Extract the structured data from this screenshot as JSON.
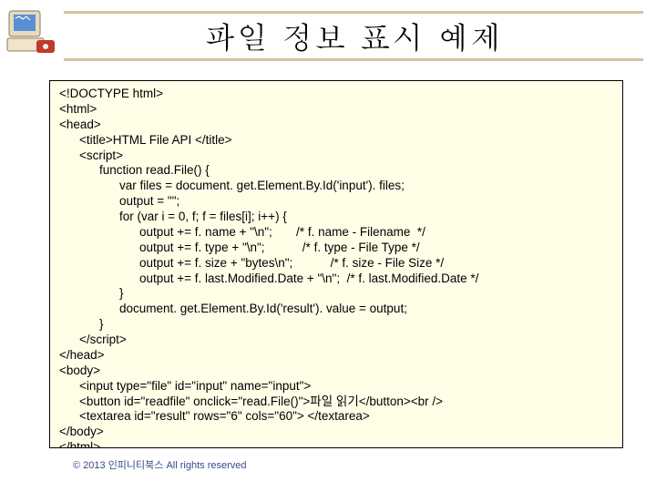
{
  "title": "파일 정보 표시 예제",
  "code": {
    "l01": "<!DOCTYPE html>",
    "l02": "<html>",
    "l03": "<head>",
    "l04": "<title>HTML File API </title>",
    "l05": "<script>",
    "l06": "function read.File() {",
    "l07": "var files = document. get.Element.By.Id('input'). files;",
    "l08": "output = \"\";",
    "l09": "for (var i = 0, f; f = files[i]; i++) {",
    "l10": "output += f. name + \"\\n\";       /* f. name - Filename  */",
    "l11": "output += f. type + \"\\n\";           /* f. type - File Type */",
    "l12": "output += f. size + \"bytes\\n\";           /* f. size - File Size */",
    "l13": "output += f. last.Modified.Date + \"\\n\";  /* f. last.Modified.Date */",
    "l14": "}",
    "l15": "document. get.Element.By.Id('result'). value = output;",
    "l16": "}",
    "l17": "</script>",
    "l18": "</head>",
    "l19": "<body>",
    "l20": "<input type=\"file\" id=\"input\" name=\"input\">",
    "l21": "<button id=\"readfile\" onclick=\"read.File()\">파일 읽기</button><br />",
    "l22": "<textarea id=\"result\" rows=\"6\" cols=\"60\"> </textarea>",
    "l23": "</body>",
    "l24": "</html>"
  },
  "footer": "© 2013 인피니티북스 All rights reserved"
}
